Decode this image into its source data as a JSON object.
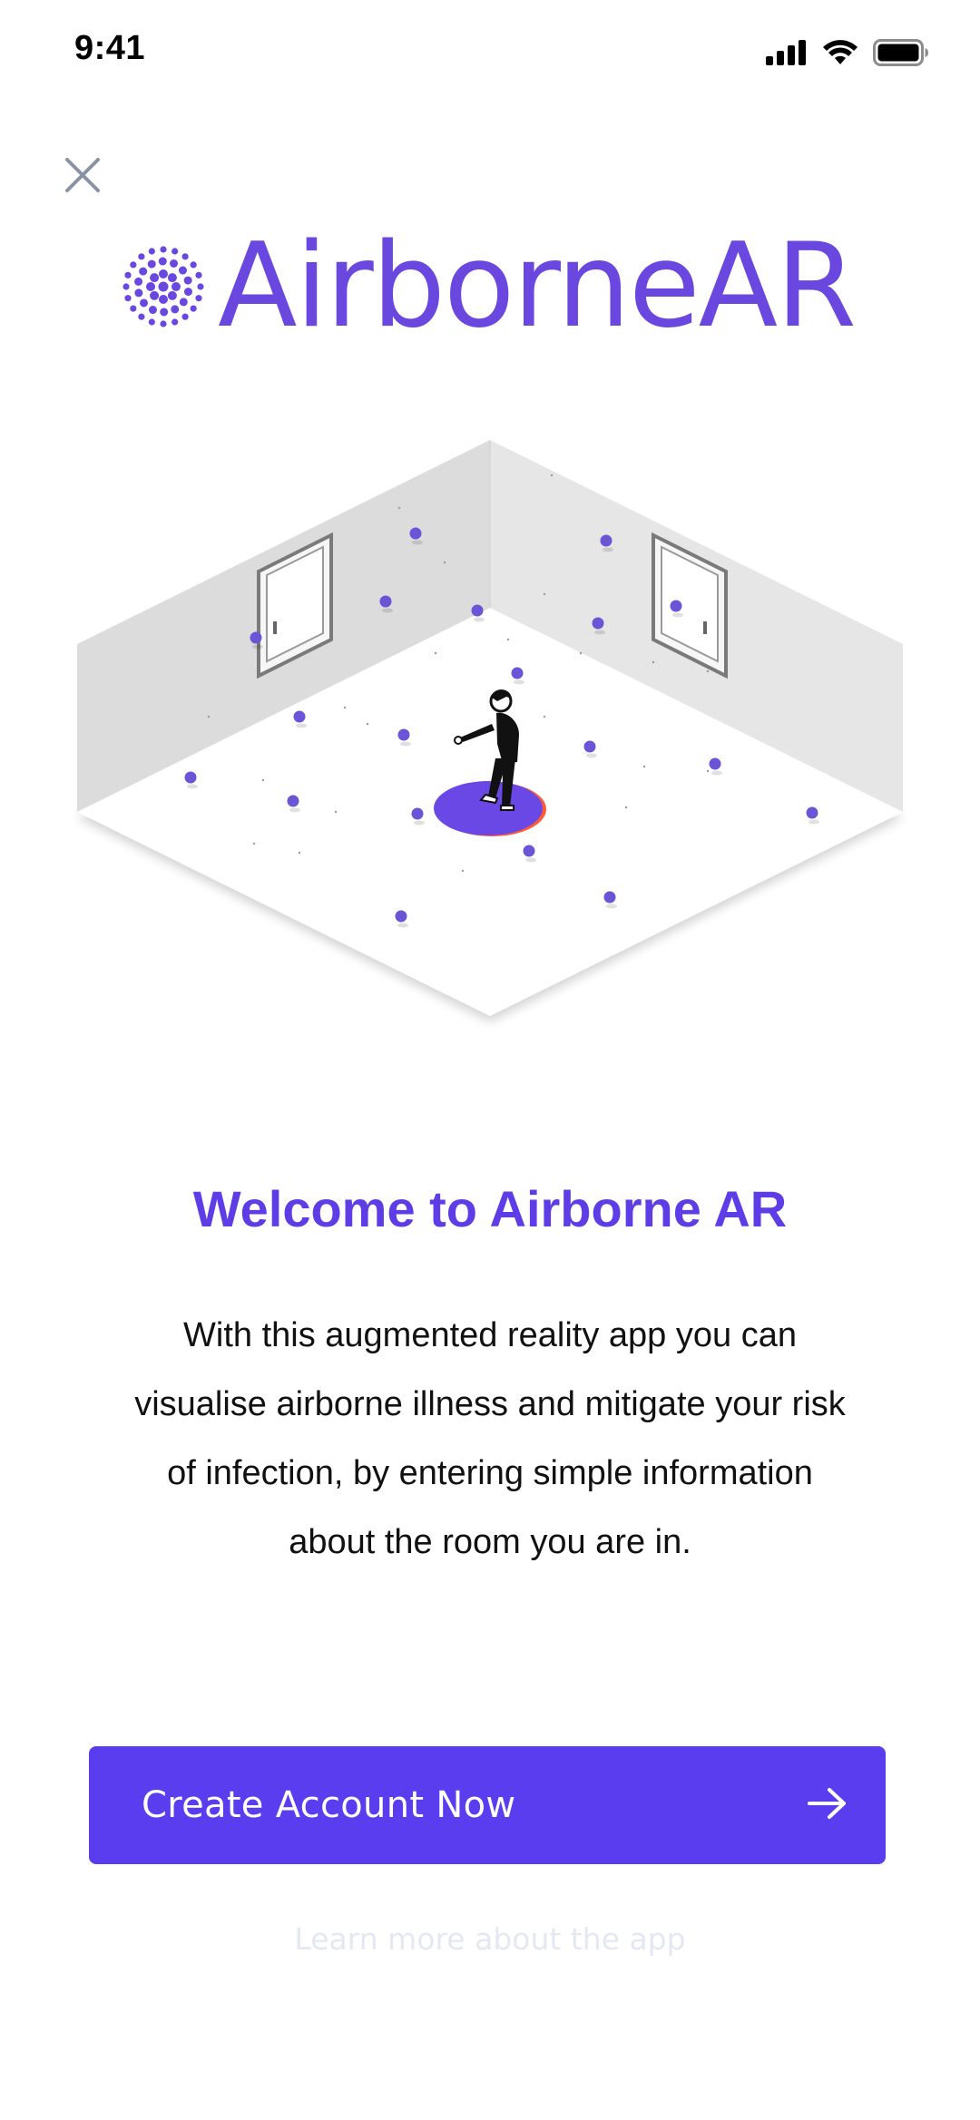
{
  "status_bar": {
    "time": "9:41",
    "icons": [
      "cellular-signal-icon",
      "wifi-icon",
      "battery-icon"
    ]
  },
  "header": {
    "close_icon": "close-icon"
  },
  "logo": {
    "text": "AirborneAR",
    "mark_icon": "dotted-particle-logo-icon",
    "color": "#6a48e0"
  },
  "illustration": {
    "description_icon": "isometric-room-with-airborne-particles-icon",
    "accent_color": "#6b55d6"
  },
  "welcome": {
    "title": "Welcome to Airborne AR",
    "body_lines": [
      "With this augmented reality app you can",
      "visualise airborne illness and mitigate your risk",
      "of infection, by entering simple information",
      "about the room you are in."
    ]
  },
  "cta": {
    "label": "Create Account Now",
    "icon": "arrow-right-icon",
    "color": "#5b3df0"
  },
  "secondary_link": {
    "label": "Learn more about the app"
  }
}
